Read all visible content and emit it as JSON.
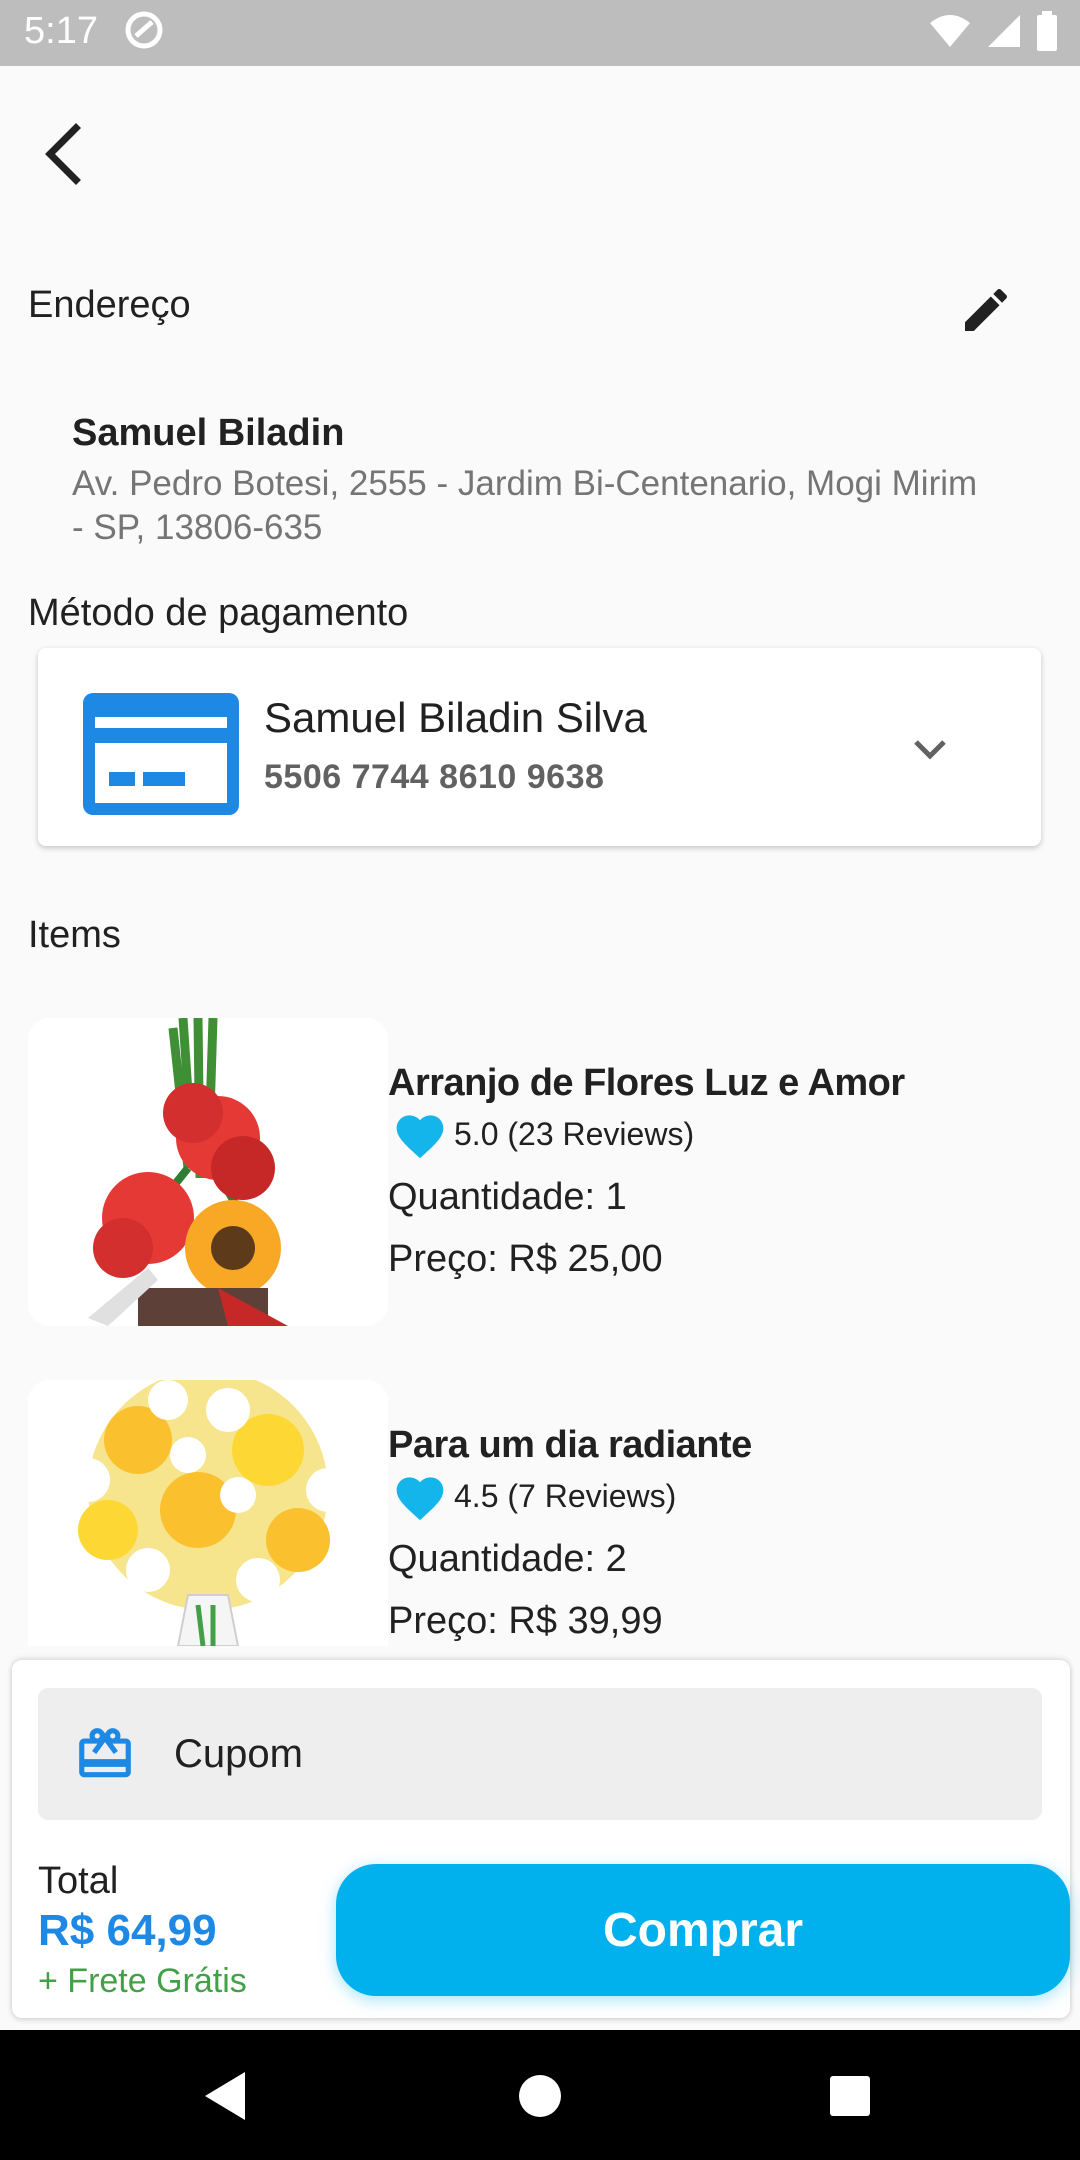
{
  "status_bar": {
    "time": "5:17"
  },
  "address": {
    "section_title": "Endereço",
    "name": "Samuel Biladin",
    "line": "Av. Pedro Botesi, 2555 - Jardim Bi-Centenario, Mogi Mirim - SP, 13806-635"
  },
  "payment": {
    "section_title": "Método de pagamento",
    "holder": "Samuel Biladin Silva",
    "number": "5506 7744 8610 9638"
  },
  "items": {
    "section_title": "Items",
    "list": [
      {
        "title": "Arranjo de Flores Luz e Amor",
        "rating": "5.0 (23 Reviews)",
        "quantity": "Quantidade: 1",
        "price": "Preço: R$ 25,00"
      },
      {
        "title": "Para um dia radiante",
        "rating": "4.5 (7 Reviews)",
        "quantity": "Quantidade: 2",
        "price": "Preço: R$ 39,99"
      }
    ]
  },
  "checkout": {
    "coupon_label": "Cupom",
    "total_label": "Total",
    "total_value": "R$ 64,99",
    "shipping": "+ Frete Grátis",
    "buy_label": "Comprar"
  },
  "colors": {
    "accent": "#00b1ee",
    "price_blue": "#1e88e5",
    "card_blue": "#1e88e5",
    "heart": "#13b5ea",
    "free_shipping": "#43a047"
  },
  "icons": [
    "back-arrow-icon",
    "edit-pencil-icon",
    "credit-card-icon",
    "chevron-down-icon",
    "heart-icon",
    "gift-icon"
  ]
}
